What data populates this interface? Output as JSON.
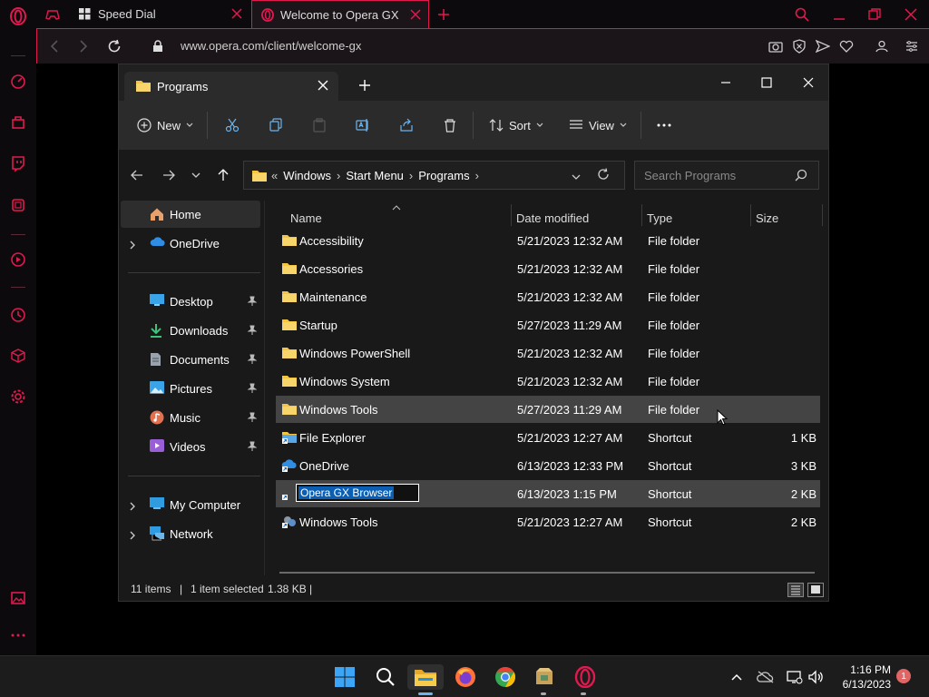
{
  "browser": {
    "tabs": [
      {
        "label": "Speed Dial"
      },
      {
        "label": "Welcome to Opera GX"
      }
    ],
    "url": "www.opera.com/client/welcome-gx",
    "accent": "#e0194f"
  },
  "explorer": {
    "tab_title": "Programs",
    "toolbar": {
      "new_label": "New",
      "sort_label": "Sort",
      "view_label": "View"
    },
    "breadcrumb": [
      "Windows",
      "Start Menu",
      "Programs"
    ],
    "breadcrumb_overflow": "«",
    "search_placeholder": "Search Programs",
    "nav": {
      "home": "Home",
      "onedrive": "OneDrive",
      "quick": [
        {
          "label": "Desktop"
        },
        {
          "label": "Downloads"
        },
        {
          "label": "Documents"
        },
        {
          "label": "Pictures"
        },
        {
          "label": "Music"
        },
        {
          "label": "Videos"
        }
      ],
      "my_computer": "My Computer",
      "network": "Network"
    },
    "columns": {
      "name": "Name",
      "date": "Date modified",
      "type": "Type",
      "size": "Size"
    },
    "files": [
      {
        "name": "Accessibility",
        "date": "5/21/2023 12:32 AM",
        "type": "File folder",
        "size": ""
      },
      {
        "name": "Accessories",
        "date": "5/21/2023 12:32 AM",
        "type": "File folder",
        "size": ""
      },
      {
        "name": "Maintenance",
        "date": "5/21/2023 12:32 AM",
        "type": "File folder",
        "size": ""
      },
      {
        "name": "Startup",
        "date": "5/27/2023 11:29 AM",
        "type": "File folder",
        "size": ""
      },
      {
        "name": "Windows PowerShell",
        "date": "5/21/2023 12:32 AM",
        "type": "File folder",
        "size": ""
      },
      {
        "name": "Windows System",
        "date": "5/21/2023 12:32 AM",
        "type": "File folder",
        "size": ""
      },
      {
        "name": "Windows Tools",
        "date": "5/27/2023 11:29 AM",
        "type": "File folder",
        "size": ""
      },
      {
        "name": "File Explorer",
        "date": "5/21/2023 12:27 AM",
        "type": "Shortcut",
        "size": "1 KB"
      },
      {
        "name": "OneDrive",
        "date": "6/13/2023 12:33 PM",
        "type": "Shortcut",
        "size": "3 KB"
      },
      {
        "name": "Opera GX Browser",
        "date": "6/13/2023 1:15 PM",
        "type": "Shortcut",
        "size": "2 KB"
      },
      {
        "name": "Windows Tools",
        "date": "5/21/2023 12:27 AM",
        "type": "Shortcut",
        "size": "2 KB"
      }
    ],
    "status": {
      "items": "11 items",
      "selected": "1 item selected",
      "selected_size": "1.38 KB"
    }
  },
  "taskbar": {
    "time": "1:16 PM",
    "date": "6/13/2023",
    "notifications": "1"
  }
}
